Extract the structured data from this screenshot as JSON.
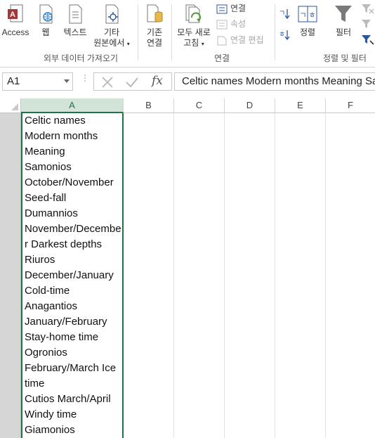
{
  "ribbon": {
    "external_data": {
      "access_label": "Access",
      "web_label": "웹",
      "text_label": "텍스트",
      "other_line1": "기타",
      "other_line2": "원본에서",
      "group_label": "외부 데이터 가져오기"
    },
    "existing_label_1": "기존",
    "existing_label_2": "연결",
    "connections": {
      "refresh_line1": "모두 새로",
      "refresh_line2": "고침",
      "connections_label": "연결",
      "properties_label": "속성",
      "edit_links_label": "연결 편집",
      "group_label": "연결"
    },
    "sort_filter": {
      "sort_label": "정렬",
      "filter_label": "필터",
      "group_label": "정렬 및 필터"
    },
    "colors": {
      "excel_green": "#217346",
      "access_red": "#a4373a",
      "link_blue": "#2b579a"
    }
  },
  "formula_bar": {
    "name_box": "A1",
    "fx_label": "fx",
    "formula": "Celtic names Modern months Meaning Samonios October/November Seed-fall Dumannios November/December Darkest depths Riuros December/January Cold-time Anagantios January/February Stay-home time Ogronios February/March Ice time Cutios March/April Windy time Giamonios"
  },
  "grid": {
    "columns": [
      "A",
      "B",
      "C",
      "D",
      "E",
      "F"
    ],
    "selected_column": "A",
    "cell_a1_lines": [
      "Celtic names",
      "Modern months",
      "Meaning",
      "Samonios",
      "October/November",
      "Seed-fall",
      "Dumannios",
      "November/Decembe",
      "r Darkest depths",
      "Riuros",
      "December/January",
      "Cold-time",
      "Anagantios",
      "January/February",
      "Stay-home time",
      "Ogronios",
      "February/March Ice",
      "time",
      "Cutios March/April",
      "Windy time",
      "Giamonios"
    ]
  }
}
